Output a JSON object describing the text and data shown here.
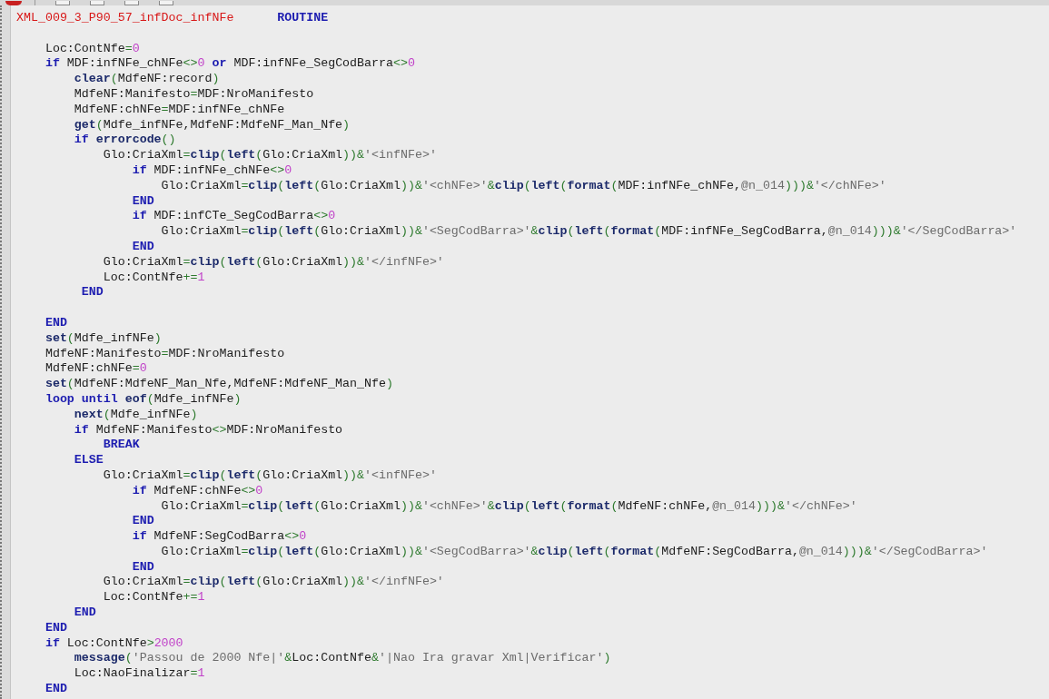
{
  "editor": {
    "lines": [
      {
        "kind": "code",
        "tokens": [
          {
            "text": "XML_009_3_P90_57_infDoc_infNFe",
            "kind": "label"
          },
          {
            "text": "      ROUTINE",
            "kind": "keyword"
          }
        ]
      },
      {
        "kind": "blank"
      },
      {
        "kind": "code",
        "tokens": [
          {
            "text": "    Loc:ContNfe",
            "kind": "plain"
          },
          {
            "text": "=",
            "kind": "operator"
          },
          {
            "text": "0",
            "kind": "number"
          }
        ]
      },
      {
        "kind": "code",
        "tokens": [
          {
            "text": "    if",
            "kind": "keyword"
          },
          {
            "text": " MDF:infNFe_chNFe",
            "kind": "plain"
          },
          {
            "text": "<>",
            "kind": "operator"
          },
          {
            "text": "0",
            "kind": "number"
          },
          {
            "text": " or",
            "kind": "keyword"
          },
          {
            "text": " MDF:infNFe_SegCodBarra",
            "kind": "plain"
          },
          {
            "text": "<>",
            "kind": "operator"
          },
          {
            "text": "0",
            "kind": "number"
          }
        ]
      },
      {
        "kind": "code",
        "tokens": [
          {
            "text": "        clear",
            "kind": "function"
          },
          {
            "text": "(",
            "kind": "operator"
          },
          {
            "text": "MdfeNF:record",
            "kind": "plain"
          },
          {
            "text": ")",
            "kind": "operator"
          }
        ]
      },
      {
        "kind": "code",
        "tokens": [
          {
            "text": "        MdfeNF:Manifesto",
            "kind": "plain"
          },
          {
            "text": "=",
            "kind": "operator"
          },
          {
            "text": "MDF:NroManifesto",
            "kind": "plain"
          }
        ]
      },
      {
        "kind": "code",
        "tokens": [
          {
            "text": "        MdfeNF:chNFe",
            "kind": "plain"
          },
          {
            "text": "=",
            "kind": "operator"
          },
          {
            "text": "MDF:infNFe_chNFe",
            "kind": "plain"
          }
        ]
      },
      {
        "kind": "code",
        "tokens": [
          {
            "text": "        get",
            "kind": "function"
          },
          {
            "text": "(",
            "kind": "operator"
          },
          {
            "text": "Mdfe_infNFe,MdfeNF:MdfeNF_Man_Nfe",
            "kind": "plain"
          },
          {
            "text": ")",
            "kind": "operator"
          }
        ]
      },
      {
        "kind": "code",
        "tokens": [
          {
            "text": "        if",
            "kind": "keyword"
          },
          {
            "text": " errorcode",
            "kind": "function"
          },
          {
            "text": "()",
            "kind": "operator"
          }
        ]
      },
      {
        "kind": "code",
        "tokens": [
          {
            "text": "            Glo:CriaXml",
            "kind": "plain"
          },
          {
            "text": "=",
            "kind": "operator"
          },
          {
            "text": "clip",
            "kind": "function"
          },
          {
            "text": "(",
            "kind": "operator"
          },
          {
            "text": "left",
            "kind": "function"
          },
          {
            "text": "(",
            "kind": "operator"
          },
          {
            "text": "Glo:CriaXml",
            "kind": "plain"
          },
          {
            "text": "))&",
            "kind": "operator"
          },
          {
            "text": "'<infNFe>'",
            "kind": "string"
          }
        ]
      },
      {
        "kind": "code",
        "tokens": [
          {
            "text": "                if",
            "kind": "keyword"
          },
          {
            "text": " MDF:infNFe_chNFe",
            "kind": "plain"
          },
          {
            "text": "<>",
            "kind": "operator"
          },
          {
            "text": "0",
            "kind": "number"
          }
        ]
      },
      {
        "kind": "code",
        "tokens": [
          {
            "text": "                    Glo:CriaXml",
            "kind": "plain"
          },
          {
            "text": "=",
            "kind": "operator"
          },
          {
            "text": "clip",
            "kind": "function"
          },
          {
            "text": "(",
            "kind": "operator"
          },
          {
            "text": "left",
            "kind": "function"
          },
          {
            "text": "(",
            "kind": "operator"
          },
          {
            "text": "Glo:CriaXml",
            "kind": "plain"
          },
          {
            "text": "))&",
            "kind": "operator"
          },
          {
            "text": "'<chNFe>'",
            "kind": "string"
          },
          {
            "text": "&",
            "kind": "operator"
          },
          {
            "text": "clip",
            "kind": "function"
          },
          {
            "text": "(",
            "kind": "operator"
          },
          {
            "text": "left",
            "kind": "function"
          },
          {
            "text": "(",
            "kind": "operator"
          },
          {
            "text": "format",
            "kind": "function"
          },
          {
            "text": "(",
            "kind": "operator"
          },
          {
            "text": "MDF:infNFe_chNFe,",
            "kind": "plain"
          },
          {
            "text": "@n_014",
            "kind": "string"
          },
          {
            "text": ")))&",
            "kind": "operator"
          },
          {
            "text": "'</chNFe>'",
            "kind": "string"
          }
        ]
      },
      {
        "kind": "code",
        "tokens": [
          {
            "text": "                END",
            "kind": "keyword"
          }
        ]
      },
      {
        "kind": "code",
        "tokens": [
          {
            "text": "                if",
            "kind": "keyword"
          },
          {
            "text": " MDF:infCTe_SegCodBarra",
            "kind": "plain"
          },
          {
            "text": "<>",
            "kind": "operator"
          },
          {
            "text": "0",
            "kind": "number"
          }
        ]
      },
      {
        "kind": "code",
        "tokens": [
          {
            "text": "                    Glo:CriaXml",
            "kind": "plain"
          },
          {
            "text": "=",
            "kind": "operator"
          },
          {
            "text": "clip",
            "kind": "function"
          },
          {
            "text": "(",
            "kind": "operator"
          },
          {
            "text": "left",
            "kind": "function"
          },
          {
            "text": "(",
            "kind": "operator"
          },
          {
            "text": "Glo:CriaXml",
            "kind": "plain"
          },
          {
            "text": "))&",
            "kind": "operator"
          },
          {
            "text": "'<SegCodBarra>'",
            "kind": "string"
          },
          {
            "text": "&",
            "kind": "operator"
          },
          {
            "text": "clip",
            "kind": "function"
          },
          {
            "text": "(",
            "kind": "operator"
          },
          {
            "text": "left",
            "kind": "function"
          },
          {
            "text": "(",
            "kind": "operator"
          },
          {
            "text": "format",
            "kind": "function"
          },
          {
            "text": "(",
            "kind": "operator"
          },
          {
            "text": "MDF:infNFe_SegCodBarra,",
            "kind": "plain"
          },
          {
            "text": "@n_014",
            "kind": "string"
          },
          {
            "text": ")))&",
            "kind": "operator"
          },
          {
            "text": "'</SegCodBarra>'",
            "kind": "string"
          }
        ]
      },
      {
        "kind": "code",
        "tokens": [
          {
            "text": "                END",
            "kind": "keyword"
          }
        ]
      },
      {
        "kind": "code",
        "tokens": [
          {
            "text": "            Glo:CriaXml",
            "kind": "plain"
          },
          {
            "text": "=",
            "kind": "operator"
          },
          {
            "text": "clip",
            "kind": "function"
          },
          {
            "text": "(",
            "kind": "operator"
          },
          {
            "text": "left",
            "kind": "function"
          },
          {
            "text": "(",
            "kind": "operator"
          },
          {
            "text": "Glo:CriaXml",
            "kind": "plain"
          },
          {
            "text": "))&",
            "kind": "operator"
          },
          {
            "text": "'</infNFe>'",
            "kind": "string"
          }
        ]
      },
      {
        "kind": "code",
        "tokens": [
          {
            "text": "            Loc:ContNfe",
            "kind": "plain"
          },
          {
            "text": "+=",
            "kind": "operator"
          },
          {
            "text": "1",
            "kind": "number"
          }
        ]
      },
      {
        "kind": "code",
        "tokens": [
          {
            "text": "         END",
            "kind": "keyword"
          }
        ]
      },
      {
        "kind": "blank"
      },
      {
        "kind": "code",
        "tokens": [
          {
            "text": "    END",
            "kind": "keyword"
          }
        ]
      },
      {
        "kind": "code",
        "tokens": [
          {
            "text": "    set",
            "kind": "function"
          },
          {
            "text": "(",
            "kind": "operator"
          },
          {
            "text": "Mdfe_infNFe",
            "kind": "plain"
          },
          {
            "text": ")",
            "kind": "operator"
          }
        ]
      },
      {
        "kind": "code",
        "tokens": [
          {
            "text": "    MdfeNF:Manifesto",
            "kind": "plain"
          },
          {
            "text": "=",
            "kind": "operator"
          },
          {
            "text": "MDF:NroManifesto",
            "kind": "plain"
          }
        ]
      },
      {
        "kind": "code",
        "tokens": [
          {
            "text": "    MdfeNF:chNFe",
            "kind": "plain"
          },
          {
            "text": "=",
            "kind": "operator"
          },
          {
            "text": "0",
            "kind": "number"
          }
        ]
      },
      {
        "kind": "code",
        "tokens": [
          {
            "text": "    set",
            "kind": "function"
          },
          {
            "text": "(",
            "kind": "operator"
          },
          {
            "text": "MdfeNF:MdfeNF_Man_Nfe,MdfeNF:MdfeNF_Man_Nfe",
            "kind": "plain"
          },
          {
            "text": ")",
            "kind": "operator"
          }
        ]
      },
      {
        "kind": "code",
        "tokens": [
          {
            "text": "    loop until",
            "kind": "keyword"
          },
          {
            "text": " eof",
            "kind": "function"
          },
          {
            "text": "(",
            "kind": "operator"
          },
          {
            "text": "Mdfe_infNFe",
            "kind": "plain"
          },
          {
            "text": ")",
            "kind": "operator"
          }
        ]
      },
      {
        "kind": "code",
        "tokens": [
          {
            "text": "        next",
            "kind": "function"
          },
          {
            "text": "(",
            "kind": "operator"
          },
          {
            "text": "Mdfe_infNFe",
            "kind": "plain"
          },
          {
            "text": ")",
            "kind": "operator"
          }
        ]
      },
      {
        "kind": "code",
        "tokens": [
          {
            "text": "        if",
            "kind": "keyword"
          },
          {
            "text": " MdfeNF:Manifesto",
            "kind": "plain"
          },
          {
            "text": "<>",
            "kind": "operator"
          },
          {
            "text": "MDF:NroManifesto",
            "kind": "plain"
          }
        ]
      },
      {
        "kind": "code",
        "tokens": [
          {
            "text": "            BREAK",
            "kind": "keyword"
          }
        ]
      },
      {
        "kind": "code",
        "tokens": [
          {
            "text": "        ELSE",
            "kind": "keyword"
          }
        ]
      },
      {
        "kind": "code",
        "tokens": [
          {
            "text": "            Glo:CriaXml",
            "kind": "plain"
          },
          {
            "text": "=",
            "kind": "operator"
          },
          {
            "text": "clip",
            "kind": "function"
          },
          {
            "text": "(",
            "kind": "operator"
          },
          {
            "text": "left",
            "kind": "function"
          },
          {
            "text": "(",
            "kind": "operator"
          },
          {
            "text": "Glo:CriaXml",
            "kind": "plain"
          },
          {
            "text": "))&",
            "kind": "operator"
          },
          {
            "text": "'<infNFe>'",
            "kind": "string"
          }
        ]
      },
      {
        "kind": "code",
        "tokens": [
          {
            "text": "                if",
            "kind": "keyword"
          },
          {
            "text": " MdfeNF:chNFe",
            "kind": "plain"
          },
          {
            "text": "<>",
            "kind": "operator"
          },
          {
            "text": "0",
            "kind": "number"
          }
        ]
      },
      {
        "kind": "code",
        "tokens": [
          {
            "text": "                    Glo:CriaXml",
            "kind": "plain"
          },
          {
            "text": "=",
            "kind": "operator"
          },
          {
            "text": "clip",
            "kind": "function"
          },
          {
            "text": "(",
            "kind": "operator"
          },
          {
            "text": "left",
            "kind": "function"
          },
          {
            "text": "(",
            "kind": "operator"
          },
          {
            "text": "Glo:CriaXml",
            "kind": "plain"
          },
          {
            "text": "))&",
            "kind": "operator"
          },
          {
            "text": "'<chNFe>'",
            "kind": "string"
          },
          {
            "text": "&",
            "kind": "operator"
          },
          {
            "text": "clip",
            "kind": "function"
          },
          {
            "text": "(",
            "kind": "operator"
          },
          {
            "text": "left",
            "kind": "function"
          },
          {
            "text": "(",
            "kind": "operator"
          },
          {
            "text": "format",
            "kind": "function"
          },
          {
            "text": "(",
            "kind": "operator"
          },
          {
            "text": "MdfeNF:chNFe,",
            "kind": "plain"
          },
          {
            "text": "@n_014",
            "kind": "string"
          },
          {
            "text": ")))&",
            "kind": "operator"
          },
          {
            "text": "'</chNFe>'",
            "kind": "string"
          }
        ]
      },
      {
        "kind": "code",
        "tokens": [
          {
            "text": "                END",
            "kind": "keyword"
          }
        ]
      },
      {
        "kind": "code",
        "tokens": [
          {
            "text": "                if",
            "kind": "keyword"
          },
          {
            "text": " MdfeNF:SegCodBarra",
            "kind": "plain"
          },
          {
            "text": "<>",
            "kind": "operator"
          },
          {
            "text": "0",
            "kind": "number"
          }
        ]
      },
      {
        "kind": "code",
        "tokens": [
          {
            "text": "                    Glo:CriaXml",
            "kind": "plain"
          },
          {
            "text": "=",
            "kind": "operator"
          },
          {
            "text": "clip",
            "kind": "function"
          },
          {
            "text": "(",
            "kind": "operator"
          },
          {
            "text": "left",
            "kind": "function"
          },
          {
            "text": "(",
            "kind": "operator"
          },
          {
            "text": "Glo:CriaXml",
            "kind": "plain"
          },
          {
            "text": "))&",
            "kind": "operator"
          },
          {
            "text": "'<SegCodBarra>'",
            "kind": "string"
          },
          {
            "text": "&",
            "kind": "operator"
          },
          {
            "text": "clip",
            "kind": "function"
          },
          {
            "text": "(",
            "kind": "operator"
          },
          {
            "text": "left",
            "kind": "function"
          },
          {
            "text": "(",
            "kind": "operator"
          },
          {
            "text": "format",
            "kind": "function"
          },
          {
            "text": "(",
            "kind": "operator"
          },
          {
            "text": "MdfeNF:SegCodBarra,",
            "kind": "plain"
          },
          {
            "text": "@n_014",
            "kind": "string"
          },
          {
            "text": ")))&",
            "kind": "operator"
          },
          {
            "text": "'</SegCodBarra>'",
            "kind": "string"
          }
        ]
      },
      {
        "kind": "code",
        "tokens": [
          {
            "text": "                END",
            "kind": "keyword"
          }
        ]
      },
      {
        "kind": "code",
        "tokens": [
          {
            "text": "            Glo:CriaXml",
            "kind": "plain"
          },
          {
            "text": "=",
            "kind": "operator"
          },
          {
            "text": "clip",
            "kind": "function"
          },
          {
            "text": "(",
            "kind": "operator"
          },
          {
            "text": "left",
            "kind": "function"
          },
          {
            "text": "(",
            "kind": "operator"
          },
          {
            "text": "Glo:CriaXml",
            "kind": "plain"
          },
          {
            "text": "))&",
            "kind": "operator"
          },
          {
            "text": "'</infNFe>'",
            "kind": "string"
          }
        ]
      },
      {
        "kind": "code",
        "tokens": [
          {
            "text": "            Loc:ContNfe",
            "kind": "plain"
          },
          {
            "text": "+=",
            "kind": "operator"
          },
          {
            "text": "1",
            "kind": "number"
          }
        ]
      },
      {
        "kind": "code",
        "tokens": [
          {
            "text": "        END",
            "kind": "keyword"
          }
        ]
      },
      {
        "kind": "code",
        "tokens": [
          {
            "text": "    END",
            "kind": "keyword"
          }
        ]
      },
      {
        "kind": "code",
        "tokens": [
          {
            "text": "    if",
            "kind": "keyword"
          },
          {
            "text": " Loc:ContNfe",
            "kind": "plain"
          },
          {
            "text": ">",
            "kind": "operator"
          },
          {
            "text": "2000",
            "kind": "number"
          }
        ]
      },
      {
        "kind": "code",
        "tokens": [
          {
            "text": "        message",
            "kind": "function"
          },
          {
            "text": "(",
            "kind": "operator"
          },
          {
            "text": "'Passou de 2000 Nfe|'",
            "kind": "string"
          },
          {
            "text": "&",
            "kind": "operator"
          },
          {
            "text": "Loc:ContNfe",
            "kind": "plain"
          },
          {
            "text": "&",
            "kind": "operator"
          },
          {
            "text": "'|Nao Ira gravar Xml|Verificar'",
            "kind": "string"
          },
          {
            "text": ")",
            "kind": "operator"
          }
        ]
      },
      {
        "kind": "code",
        "tokens": [
          {
            "text": "        Loc:NaoFinalizar",
            "kind": "plain"
          },
          {
            "text": "=",
            "kind": "operator"
          },
          {
            "text": "1",
            "kind": "number"
          }
        ]
      },
      {
        "kind": "code",
        "tokens": [
          {
            "text": "    END",
            "kind": "keyword"
          }
        ]
      }
    ]
  }
}
